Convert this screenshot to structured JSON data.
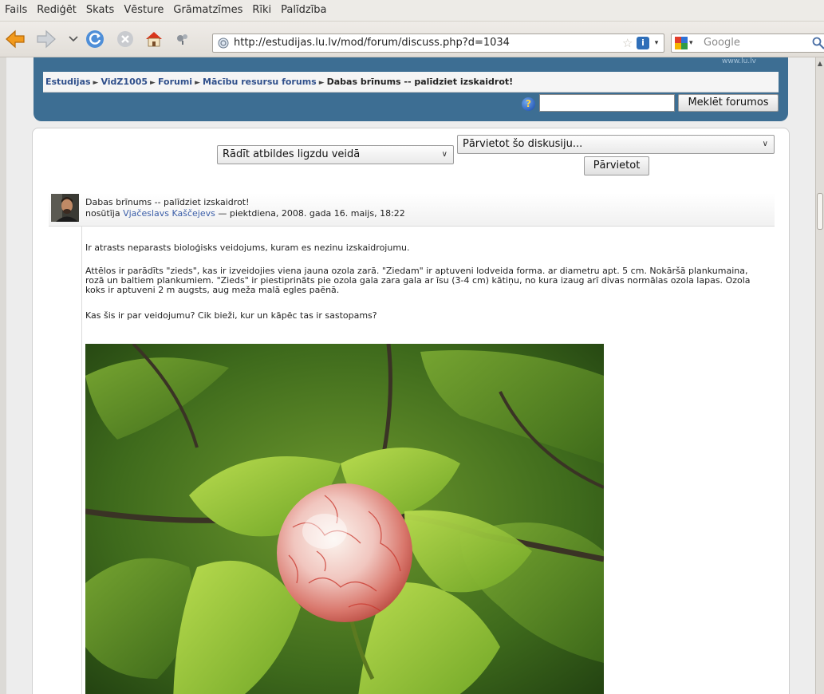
{
  "browser": {
    "menu": [
      "Fails",
      "Rediģēt",
      "Skats",
      "Vēsture",
      "Grāmatzīmes",
      "Rīki",
      "Palīdzība"
    ],
    "url": "http://estudijas.lu.lv/mod/forum/discuss.php?d=1034",
    "search_placeholder": "Google",
    "icons": [
      "back-arrow-icon",
      "forward-arrow-icon",
      "history-dropdown-icon",
      "reload-icon",
      "stop-icon",
      "home-icon",
      "downloads-icon",
      "site-identity-icon",
      "bookmark-star-icon",
      "feed-icon",
      "search-engine-icon",
      "search-magnifier-icon"
    ]
  },
  "header": {
    "site_link": "www.lu.lv",
    "breadcrumb": [
      "Estudijas",
      "VidZ1005",
      "Forumi",
      "Mācību resursu forums",
      "Dabas brīnums -- palīdziet izskaidrot!"
    ],
    "search_button": "Meklēt forumos"
  },
  "controls": {
    "display_mode": "Rādīt atbildes ligzdu veidā",
    "move_select": "Pārvietot šo diskusiju...",
    "move_button": "Pārvietot"
  },
  "post": {
    "subject": "Dabas brīnums -- palīdziet izskaidrot!",
    "byline_prefix": "nosūtīja",
    "author": "Vjačeslavs Kaščejevs",
    "byline_suffix": "— piektdiena, 2008. gada 16. maijs, 18:22",
    "paragraphs": [
      "Ir atrasts neparasts bioloģisks veidojums, kuram es nezinu izskaidrojumu.",
      "Attēlos ir parādīts \"zieds\", kas ir izveidojies viena jauna ozola zarā. \"Ziedam\" ir aptuveni lodveida forma. ar diametru apt. 5 cm. Nokāršā plankumaina, rozā un baltiem plankumiem. \"Zieds\" ir piestiprināts pie ozola gala zara gala ar īsu (3-4 cm) kātiņu, no kura izaug arī divas normālas ozola lapas. Ozola koks ir aptuveni 2 m augsts, aug meža malā egles paēnā.",
      "Kas šis ir par veidojumu? Cik bieži, kur un kāpēc tas ir sastopams?"
    ]
  },
  "colors": {
    "header_band": "#3d6e93",
    "link": "#2f4f8b"
  }
}
